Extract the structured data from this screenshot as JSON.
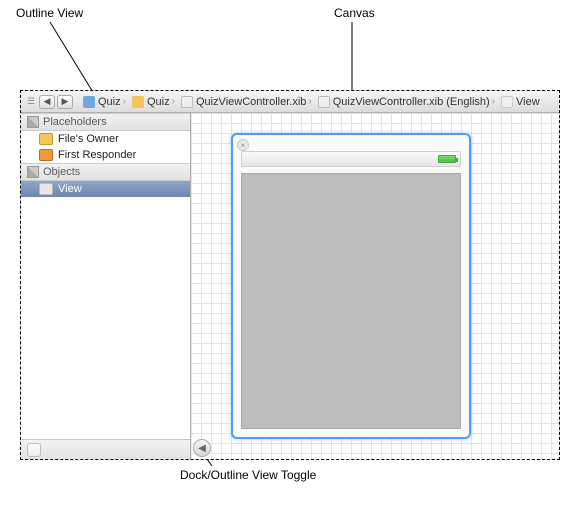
{
  "annotations": {
    "outline_view": "Outline View",
    "canvas": "Canvas",
    "dock_toggle": "Dock/Outline View Toggle"
  },
  "toolbar": {
    "back": "◀",
    "forward": "▶",
    "crumbs": [
      {
        "label": "Quiz",
        "icon": "ic-proj"
      },
      {
        "label": "Quiz",
        "icon": "ic-folder"
      },
      {
        "label": "QuizViewController.xib",
        "icon": "ic-xib"
      },
      {
        "label": "QuizViewController.xib (English)",
        "icon": "ic-xib"
      },
      {
        "label": "View",
        "icon": "ic-view"
      }
    ]
  },
  "outline": {
    "placeholders_header": "Placeholders",
    "placeholders": [
      {
        "label": "File's Owner"
      },
      {
        "label": "First Responder"
      }
    ],
    "objects_header": "Objects",
    "objects": [
      {
        "label": "View",
        "selected": true
      }
    ]
  },
  "dock_toggle_glyph": "◀",
  "device_close_glyph": "×"
}
